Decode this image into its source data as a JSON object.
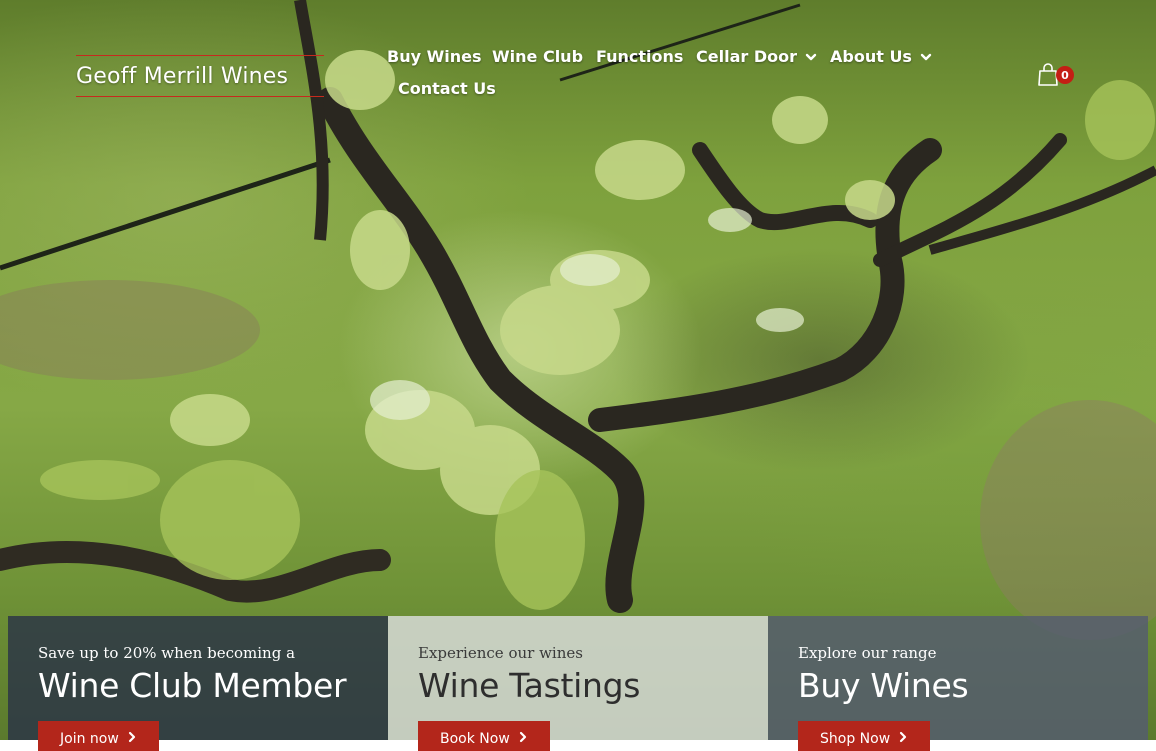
{
  "brand": {
    "name": "Geoff Merrill Wines",
    "accent": "#c62a1e"
  },
  "nav": {
    "items": [
      {
        "label": "Buy Wines",
        "has_dropdown": false
      },
      {
        "label": "Wine Club",
        "has_dropdown": false
      },
      {
        "label": "Functions",
        "has_dropdown": false
      },
      {
        "label": "Cellar Door",
        "has_dropdown": true
      },
      {
        "label": "About Us",
        "has_dropdown": true
      },
      {
        "label": "Contact Us",
        "has_dropdown": false
      }
    ],
    "cart": {
      "icon": "shopping-bag-icon",
      "count": "0",
      "badge_color": "#c41e14"
    }
  },
  "hero": {
    "description_icon": "vineyard-background"
  },
  "cards": [
    {
      "eyebrow": "Save up to 20% when becoming a",
      "title": "Wine Club Member",
      "button": "Join now"
    },
    {
      "eyebrow": "Experience our wines",
      "title": "Wine Tastings",
      "button": "Book Now"
    },
    {
      "eyebrow": "Explore our range",
      "title": "Buy Wines",
      "button": "Shop Now"
    }
  ],
  "colors": {
    "button": "#b3261b",
    "card_dark": "#283048",
    "card_light": "#dcdede",
    "card_slate": "#545c70"
  }
}
